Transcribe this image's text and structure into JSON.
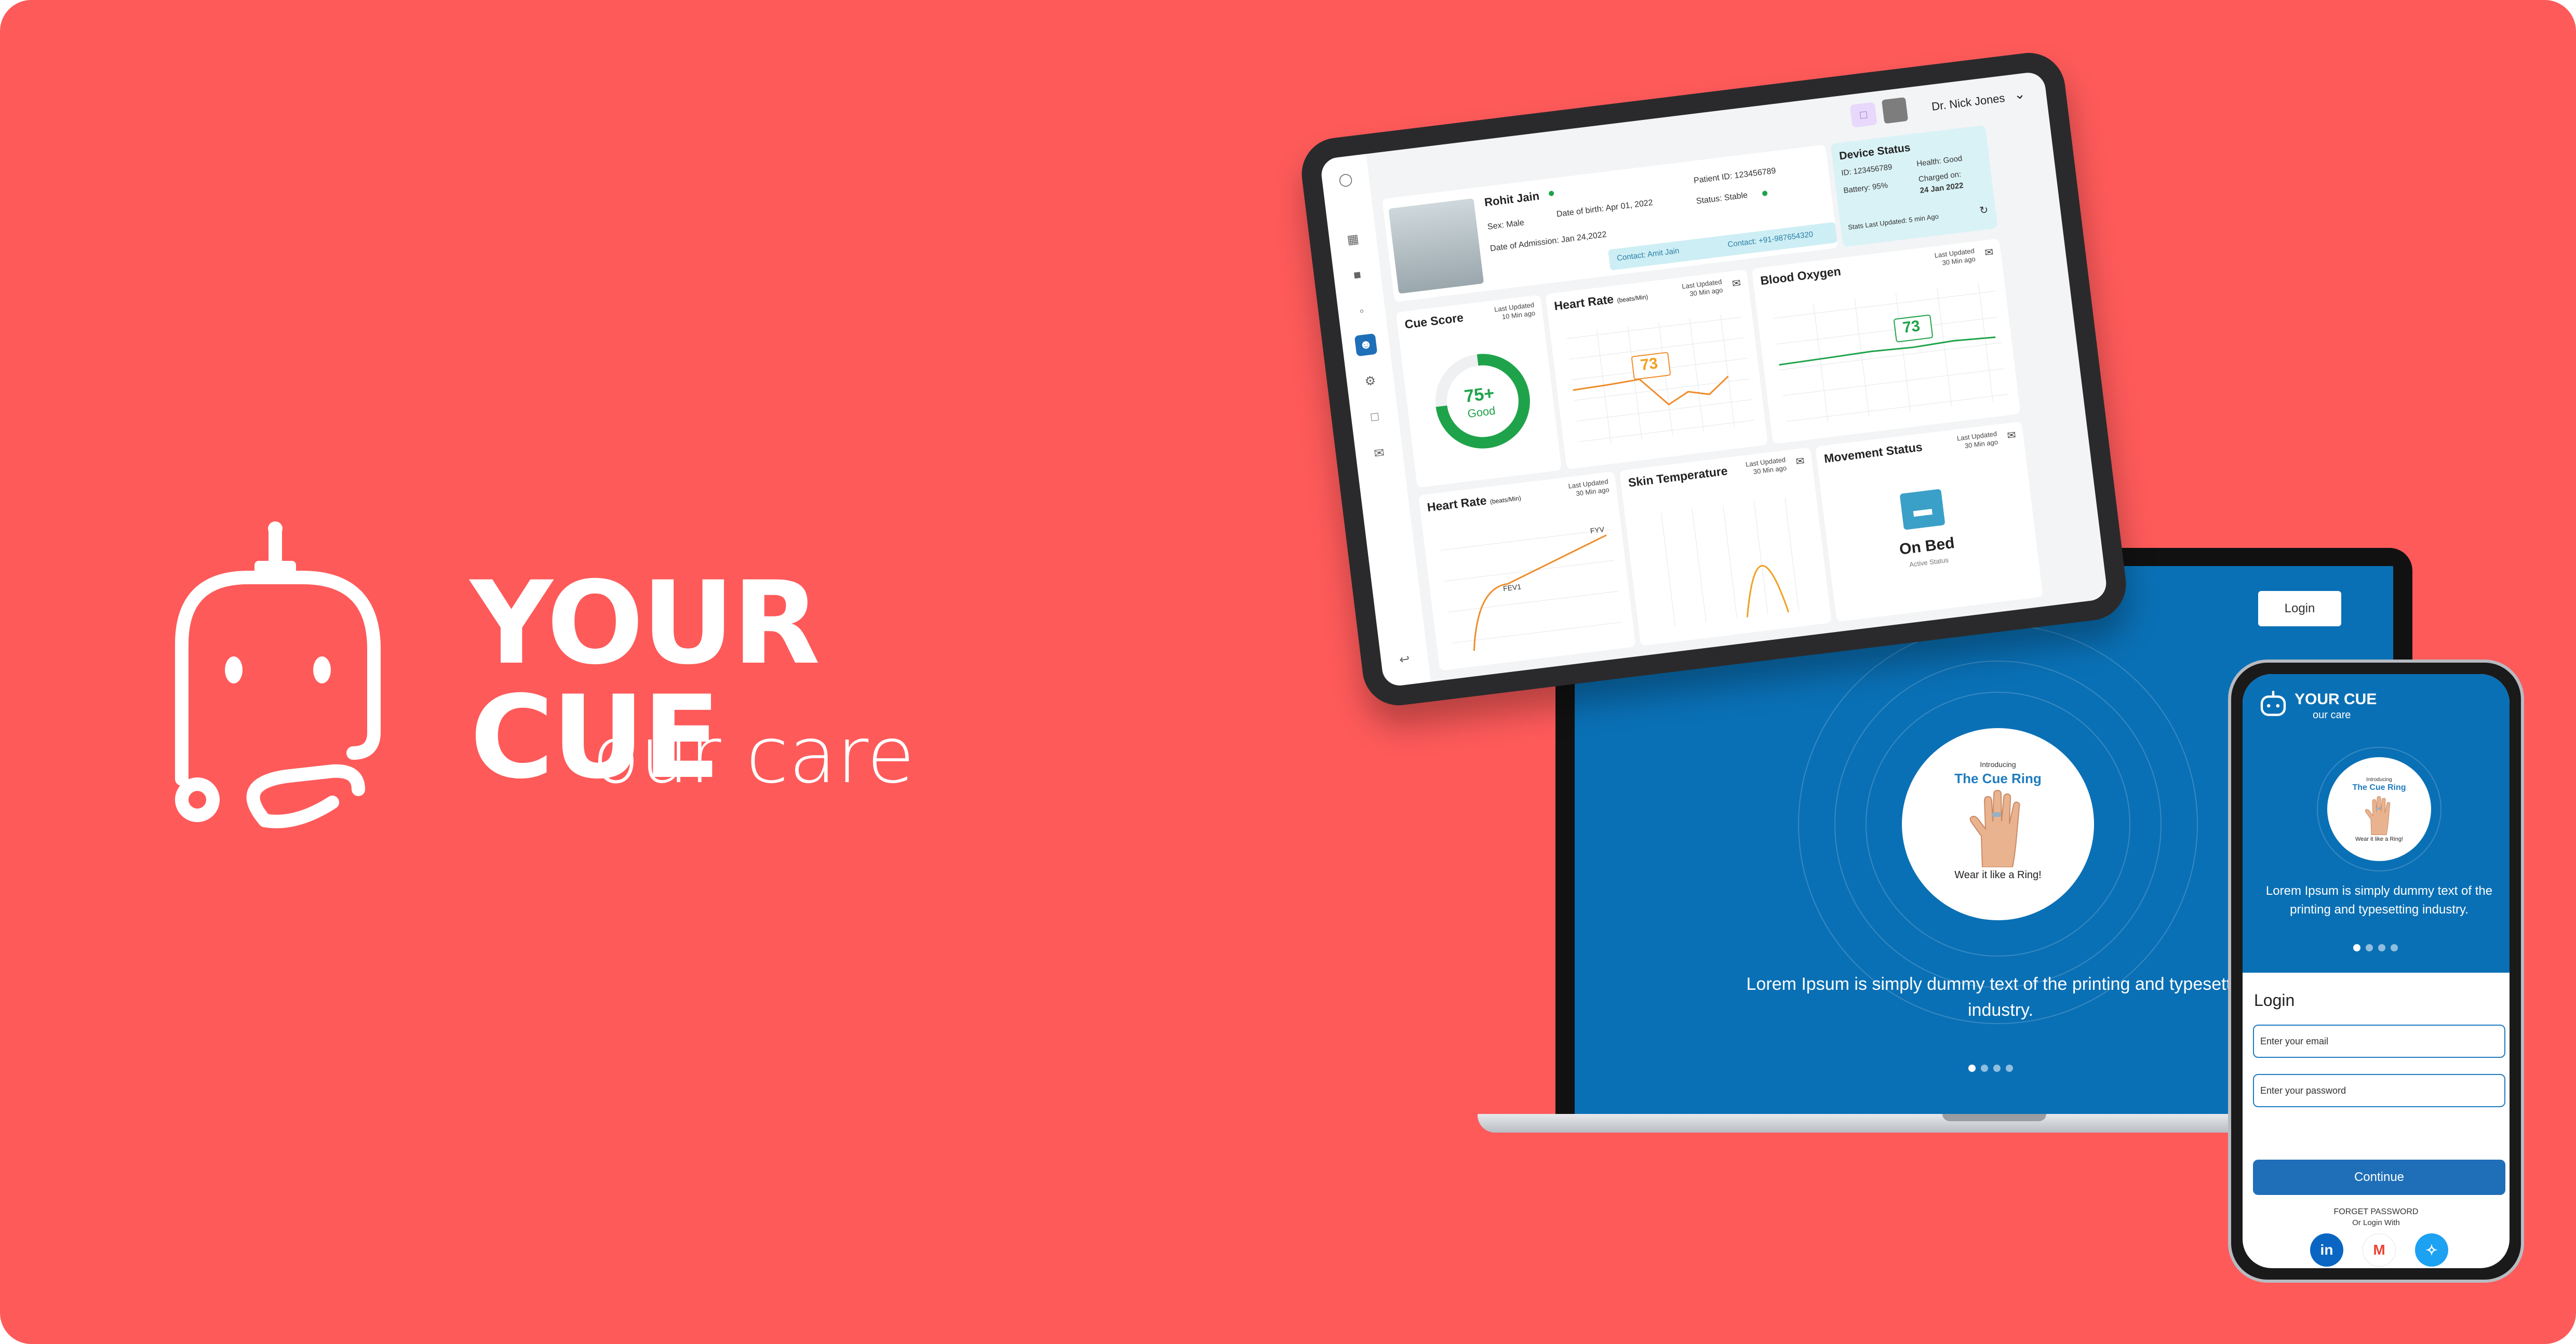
{
  "brand": {
    "title": "YOUR CUE",
    "subtitle": "our care"
  },
  "colors": {
    "background": "#fe5a5a",
    "primary_blue": "#0a70b5",
    "button_blue": "#1e6fb8",
    "good_green": "#1fa34a",
    "chart_orange": "#f08c2a"
  },
  "laptop": {
    "login_button": "Login",
    "promo": {
      "intro": "Introducing",
      "title": "The Cue Ring",
      "caption": "Wear it like a Ring!"
    },
    "description": "Lorem Ipsum is simply dummy text of the printing and typesetting industry.",
    "carousel_total": 4,
    "carousel_active": 1
  },
  "tablet": {
    "user_name": "Dr. Nick Jones",
    "patient": {
      "name": "Rohit Jain",
      "sex": "Sex: Male",
      "dob": "Date of birth: Apr 01, 2022",
      "admission": "Date of Admission: Jan 24,2022",
      "patient_id": "Patient ID: 123456789",
      "status": "Status: Stable",
      "contact_name": "Contact: Amit Jain",
      "contact_phone": "Contact: +91-987654320"
    },
    "device_status": {
      "title": "Device Status",
      "id": "ID: 123456789",
      "health": "Health: Good",
      "battery": "Battery: 95%",
      "charged_on_label": "Charged on:",
      "charged_on_date": "24 Jan 2022",
      "last_updated": "Stats Last Updated: 5 min Ago"
    },
    "cue_score": {
      "title": "Cue Score",
      "updated_label": "Last Updated",
      "updated": "10 Min ago",
      "value": "75+",
      "label": "Good",
      "fraction": 0.75
    },
    "heart_rate_top": {
      "title": "Heart Rate",
      "unit": "(beats/Min)",
      "updated_label": "Last Updated",
      "updated": "30 Min ago",
      "value": "73"
    },
    "blood_oxygen": {
      "title": "Blood Oxygen",
      "updated_label": "Last Updated",
      "updated": "30 Min ago",
      "value": "73"
    },
    "heart_rate_bottom": {
      "title": "Heart Rate",
      "unit": "(beats/Min)",
      "updated_label": "Last Updated",
      "updated": "30 Min ago",
      "label_a": "FYV",
      "label_b": "FEV1"
    },
    "skin_temperature": {
      "title": "Skin Temperature",
      "updated_label": "Last Updated",
      "updated": "30 Min ago"
    },
    "movement_status": {
      "title": "Movement Status",
      "updated_label": "Last Updated",
      "updated": "30 Min ago",
      "value": "On Bed",
      "sub": "Active Status"
    }
  },
  "phone": {
    "brand_title": "YOUR CUE",
    "brand_subtitle": "our care",
    "promo": {
      "intro": "Introducing",
      "title": "The Cue Ring",
      "caption": "Wear it like a Ring!"
    },
    "description": "Lorem Ipsum is simply dummy text of the printing and typesetting industry.",
    "carousel_total": 4,
    "carousel_active": 1,
    "login_title": "Login",
    "email_placeholder": "Enter your email",
    "password_placeholder": "Enter your password",
    "continue_label": "Continue",
    "forget_label": "FORGET PASSWORD",
    "or_login_label": "Or Login With",
    "socials": [
      {
        "name": "linkedin-icon",
        "glyph": "in",
        "color": "#0a66c2"
      },
      {
        "name": "gmail-icon",
        "glyph": "M",
        "color": "#ffffff"
      },
      {
        "name": "twitter-icon",
        "glyph": "t",
        "color": "#1da1f2"
      }
    ]
  }
}
